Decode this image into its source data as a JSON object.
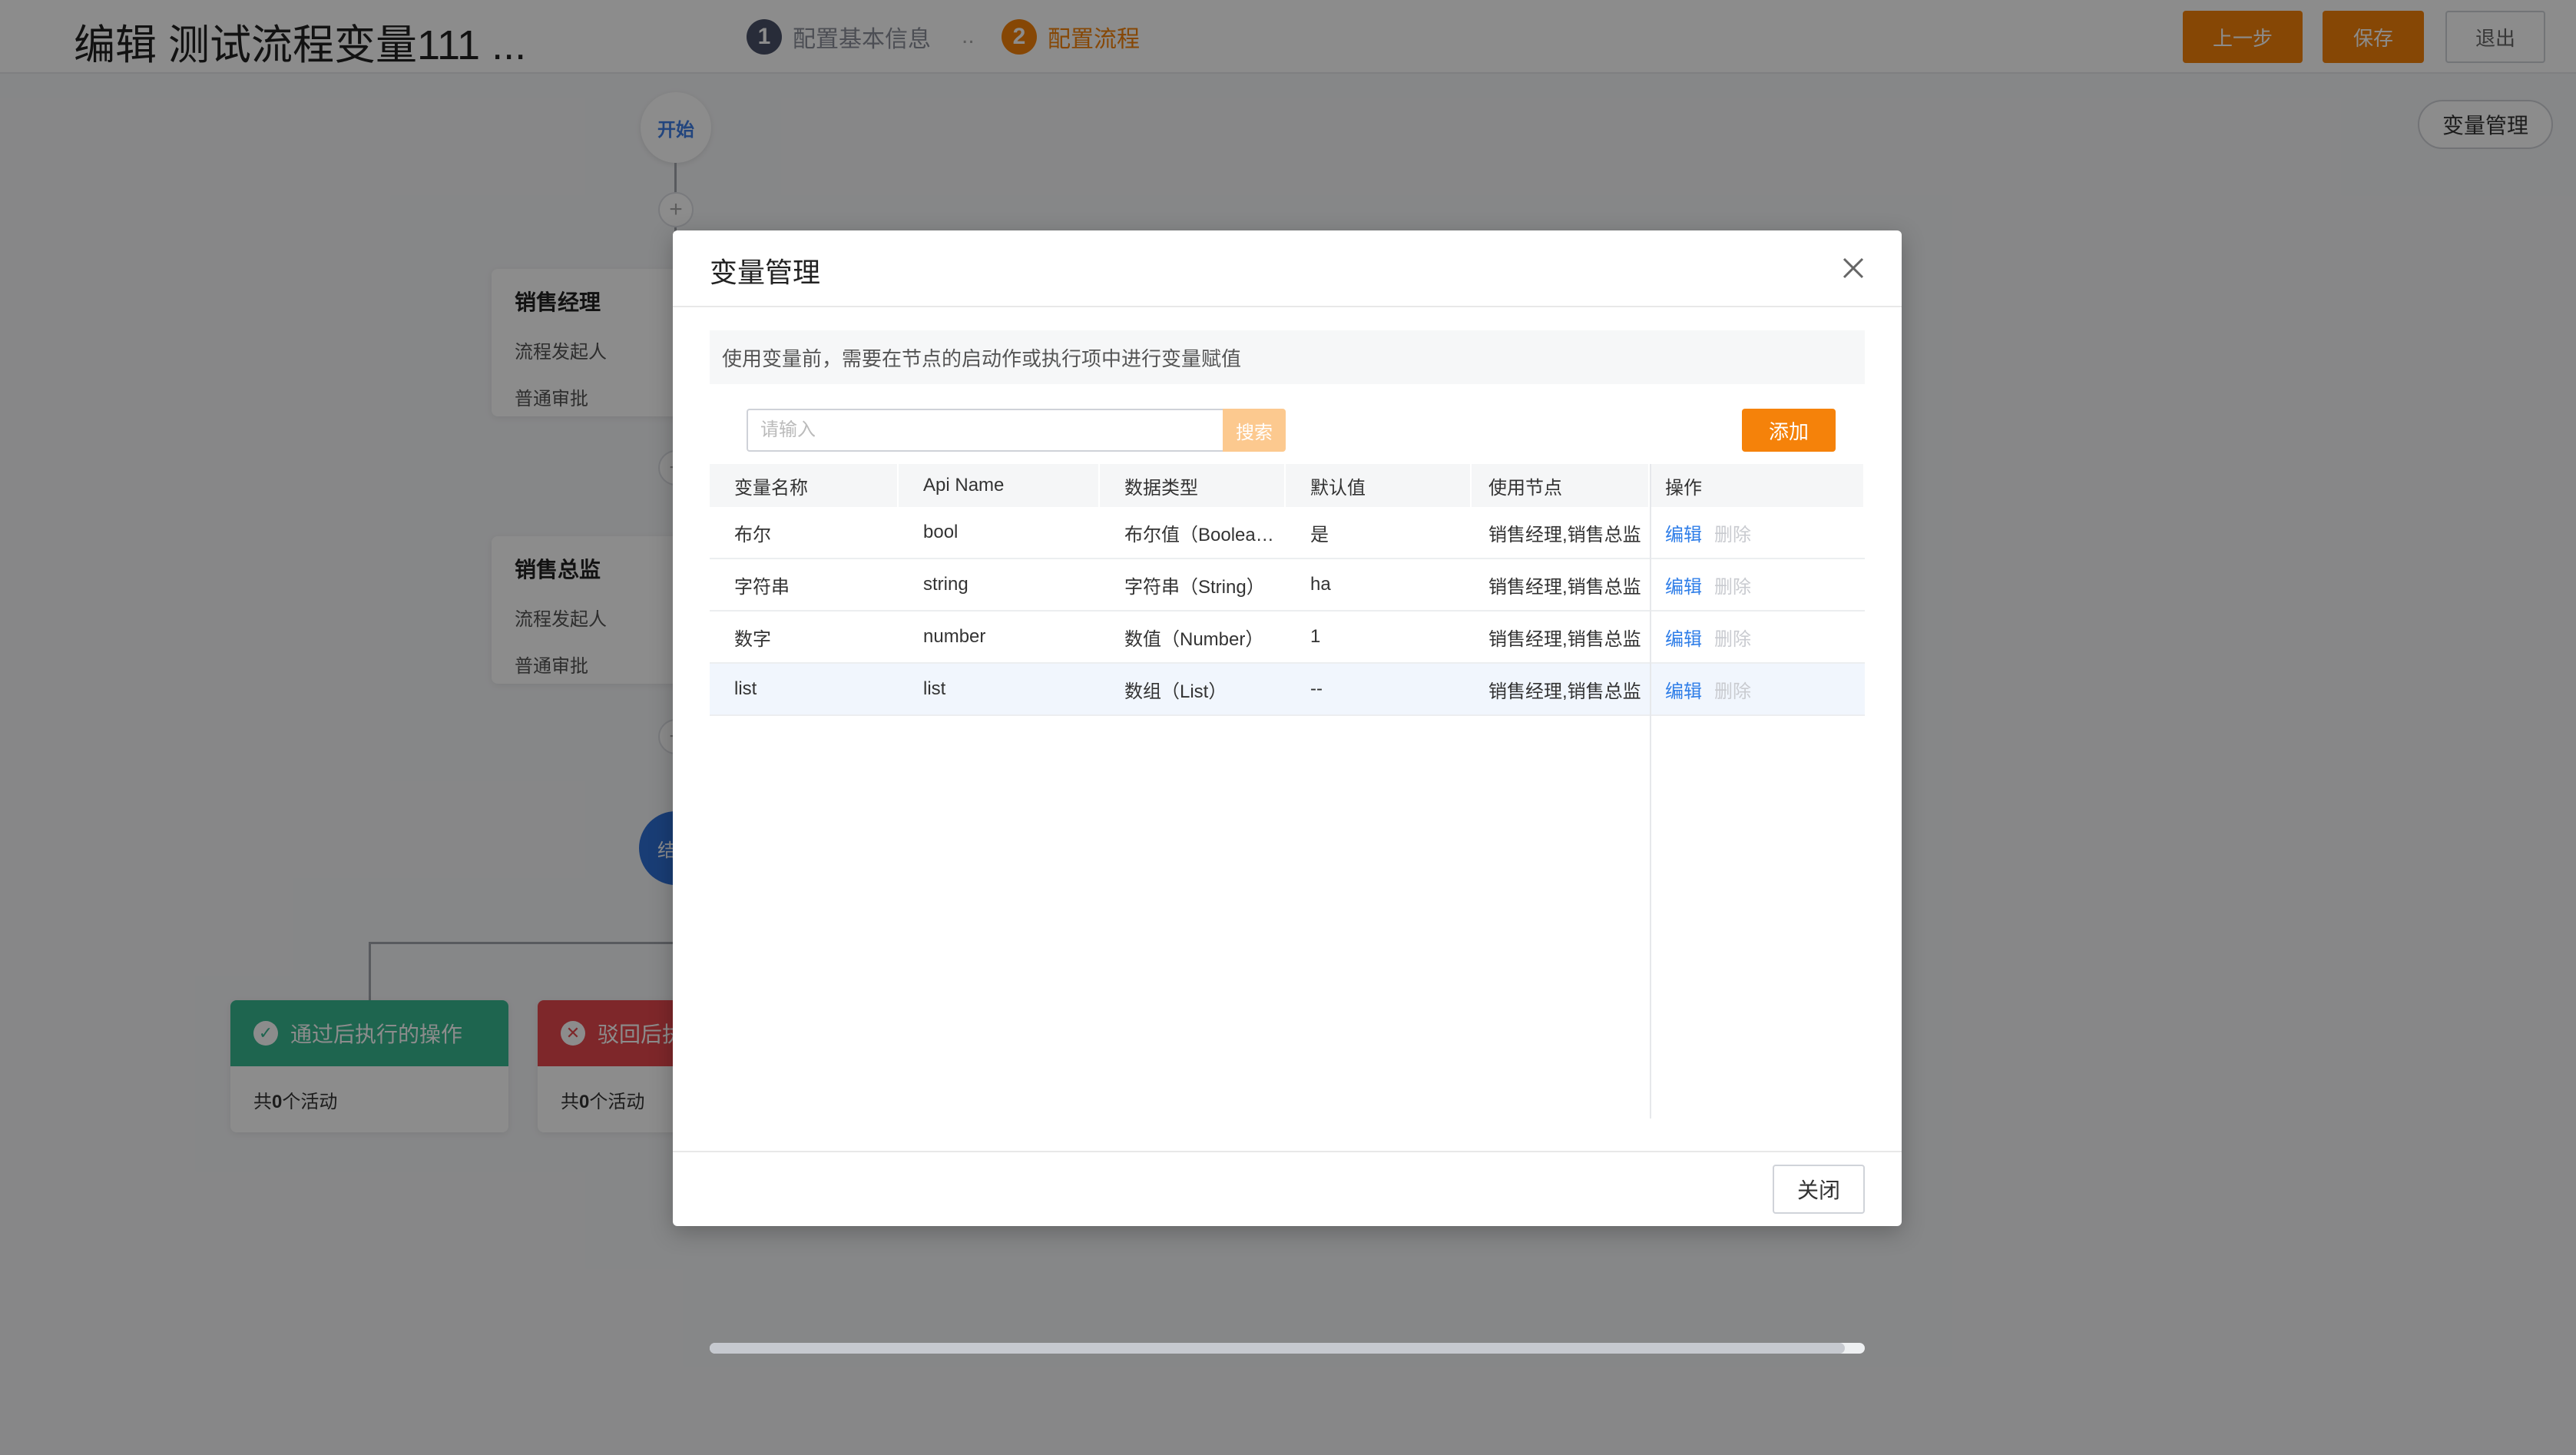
{
  "header": {
    "title": "编辑 测试流程变量111 ...",
    "steps": [
      {
        "num": "1",
        "label": "配置基本信息"
      },
      {
        "num": "2",
        "label": "配置流程"
      }
    ],
    "step_separator": "..",
    "prev_label": "上一步",
    "save_label": "保存",
    "exit_label": "退出"
  },
  "canvas": {
    "var_mgmt_label": "变量管理",
    "start_label": "开始",
    "plus_symbol": "+",
    "end_label": "结束",
    "nodes": [
      {
        "title": "销售经理",
        "initiator": "流程发起人",
        "approval": "普通审批"
      },
      {
        "title": "销售总监",
        "initiator": "流程发起人",
        "approval": "普通审批"
      }
    ],
    "actions": [
      {
        "title": "通过后执行的操作",
        "prefix": "共",
        "count": "0",
        "suffix": "个活动",
        "icon": "check-icon"
      },
      {
        "title": "驳回后执行的操作",
        "prefix": "共",
        "count": "0",
        "suffix": "个活动",
        "icon": "x-icon"
      }
    ]
  },
  "modal": {
    "title": "变量管理",
    "notice": "使用变量前，需要在节点的启动作或执行项中进行变量赋值",
    "search": {
      "placeholder": "请输入",
      "button": "搜索"
    },
    "add_label": "添加",
    "columns": [
      "变量名称",
      "Api Name",
      "数据类型",
      "默认值",
      "使用节点",
      "操作"
    ],
    "rows": [
      {
        "name": "布尔",
        "api": "bool",
        "type": "布尔值（Boolea…",
        "default": "是",
        "nodes": "销售经理,销售总监",
        "edit": "编辑",
        "delete": "删除"
      },
      {
        "name": "字符串",
        "api": "string",
        "type": "字符串（String）",
        "default": "ha",
        "nodes": "销售经理,销售总监",
        "edit": "编辑",
        "delete": "删除"
      },
      {
        "name": "数字",
        "api": "number",
        "type": "数值（Number）",
        "default": "1",
        "nodes": "销售经理,销售总监",
        "edit": "编辑",
        "delete": "删除"
      },
      {
        "name": "list",
        "api": "list",
        "type": "数组（List）",
        "default": "--",
        "nodes": "销售经理,销售总监",
        "edit": "编辑",
        "delete": "删除"
      }
    ],
    "close_label": "关闭"
  },
  "colors": {
    "accent": "#f5820a",
    "link": "#2f7ee8",
    "pass": "#37b890",
    "reject": "#e5484d",
    "end_node": "#2f6fd6"
  }
}
